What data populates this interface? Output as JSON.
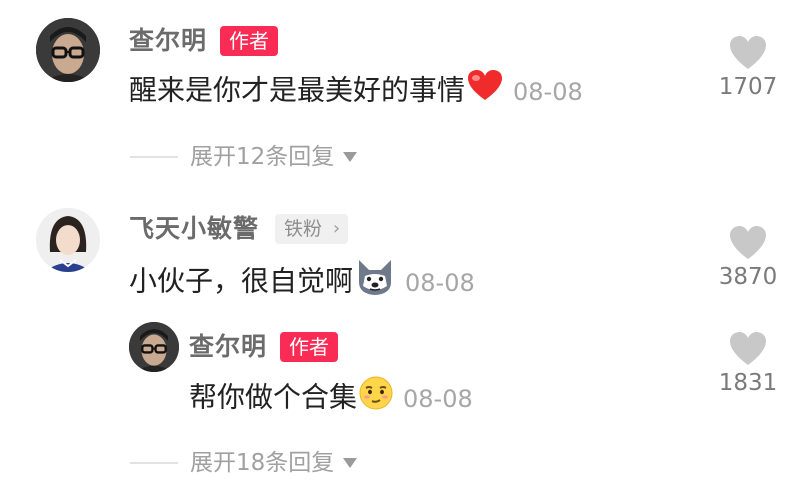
{
  "comments": [
    {
      "author": "查尔明",
      "badge": "作者",
      "text": "醒来是你才是最美好的事情",
      "emoji": "red-heart-emoji",
      "date": "08-08",
      "likes": "1707",
      "expand": "展开12条回复"
    },
    {
      "author": "飞天小敏警",
      "badge": "铁粉",
      "text": "小伙子，很自觉啊",
      "emoji": "husky-dog-emoji",
      "date": "08-08",
      "likes": "3870",
      "replies": [
        {
          "author": "查尔明",
          "badge": "作者",
          "text": "帮你做个合集",
          "emoji": "smirk-face-emoji",
          "date": "08-08",
          "likes": "1831"
        }
      ],
      "expand": "展开18条回复"
    }
  ],
  "colors": {
    "author_badge": "#fa2c55",
    "name": "#6b6b6b",
    "meta": "#a6a6a6",
    "heart": "#c8c8c8"
  }
}
